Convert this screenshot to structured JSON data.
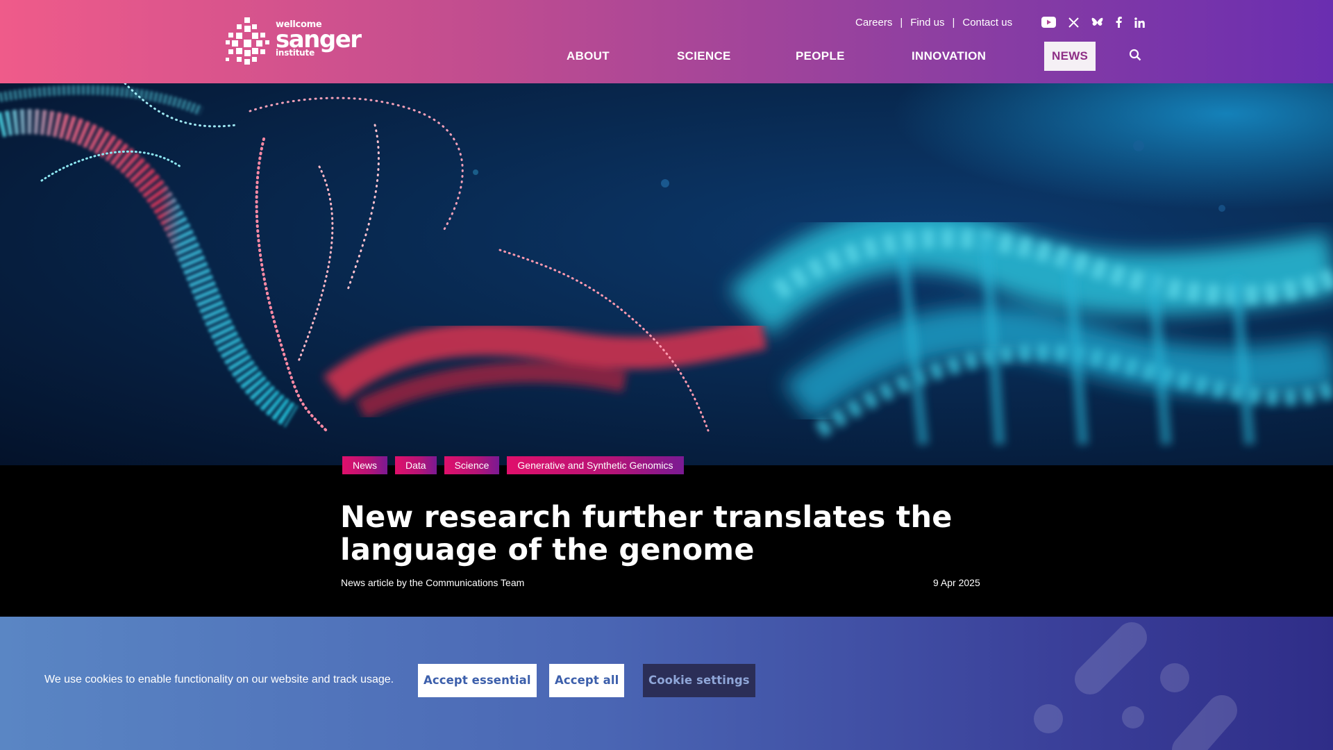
{
  "logo": {
    "line1": "wellcome",
    "line2": "sanger",
    "line3": "institute"
  },
  "utility_links": [
    "Careers",
    "Find us",
    "Contact us"
  ],
  "social_icons": [
    "youtube-icon",
    "x-icon",
    "bluesky-icon",
    "facebook-icon",
    "linkedin-icon"
  ],
  "nav": {
    "items": [
      "ABOUT",
      "SCIENCE",
      "PEOPLE",
      "INNOVATION",
      "NEWS"
    ],
    "active": "NEWS",
    "search_icon": "search-icon"
  },
  "hero": {
    "image": "dna-helix-illustration"
  },
  "article": {
    "tags": [
      "News",
      "Data",
      "Science",
      "Generative and Synthetic Genomics"
    ],
    "title_line1": "New research further translates the",
    "title_line2": "language of the genome",
    "byline": "News article by the Communications Team",
    "date": "9 Apr 2025"
  },
  "cookie_banner": {
    "text": "We use cookies to enable functionality on our website and track usage.",
    "accept_essential": "Accept essential",
    "accept_all": "Accept all",
    "settings": "Cookie settings"
  },
  "colors": {
    "header_start": "#ef5b8a",
    "header_end": "#6a2eb0",
    "tag_pink": "#e0106b",
    "cookie_blue": "#4a66b4"
  }
}
